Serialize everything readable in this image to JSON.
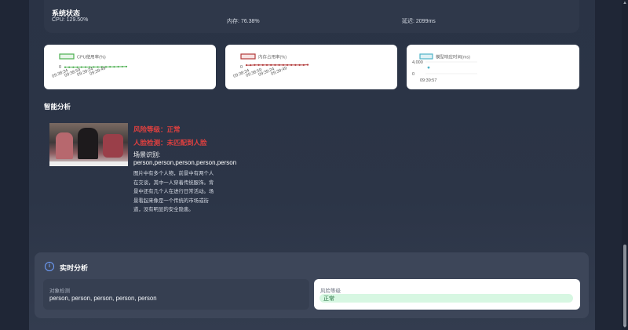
{
  "system_status": {
    "title": "系统状态",
    "cpu": "CPU: 129.50%",
    "memory": "内存: 76.38%",
    "latency": "延迟: 2099ms"
  },
  "chart_data": [
    {
      "type": "line",
      "legend": "CPU使用率(%)",
      "color": "#4caf50",
      "x": [
        "09:38:34",
        "09:38:59",
        "09:39:24",
        "09:39:49"
      ],
      "y_tick": "0",
      "ylim": [
        0,
        200
      ],
      "series": [
        {
          "name": "CPU使用率(%)",
          "values": [
            2,
            2,
            2,
            2,
            3,
            3,
            3,
            4,
            4,
            5,
            5,
            6,
            6,
            7,
            8,
            9
          ]
        }
      ]
    },
    {
      "type": "line",
      "legend": "内存占用率(%)",
      "color": "#b23a3a",
      "x": [
        "09:38:34",
        "09:38:59",
        "09:39:24",
        "09:39:49"
      ],
      "y_tick": "0",
      "ylim": [
        0,
        100
      ],
      "series": [
        {
          "name": "内存占用率(%)",
          "values": [
            12,
            12,
            13,
            13,
            13,
            13,
            13,
            13,
            13,
            13,
            13,
            13,
            13,
            13,
            13,
            14
          ]
        }
      ]
    },
    {
      "type": "line",
      "legend": "模型响应时间(ms)",
      "color": "#4fb3c8",
      "x": [
        "09:39:57"
      ],
      "y_ticks": [
        "4,000",
        "0"
      ],
      "ylim": [
        0,
        4000
      ],
      "series": [
        {
          "name": "模型响应时间(ms)",
          "values": [
            2099
          ]
        }
      ]
    }
  ],
  "analysis": {
    "title": "智能分析",
    "risk_level": "风险等级：正常",
    "face_detect": "人脸检测：未匹配到人脸",
    "scene_label": "场景识别:",
    "scene_value": "person,person,person,person,person",
    "scene_desc": "图片中有多个人物，前景中有两个人在交谈，其中一人穿着传统服饰。背景中还有几个人在进行日常活动。场景看起来像是一个传统的市场或街道，没有明显的安全隐患。"
  },
  "realtime": {
    "title": "实时分析",
    "object_label": "对象检测",
    "object_value": "person, person, person, person, person",
    "risk_label": "风险等级",
    "risk_value": "正常"
  },
  "colors": {
    "danger": "#e0403f",
    "success_bg": "#d7f7e2",
    "accent": "#6fa0ff"
  }
}
